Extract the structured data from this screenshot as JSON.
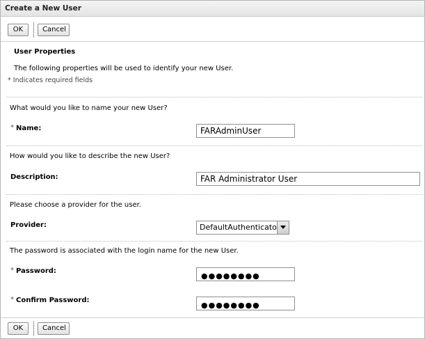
{
  "dialog": {
    "title": "Create a New User"
  },
  "buttons": {
    "ok_label": "OK",
    "cancel_label": "Cancel"
  },
  "section": {
    "heading": "User Properties",
    "intro": "The following properties will be used to identify your new User.",
    "required_note": "* Indicates required fields"
  },
  "name": {
    "prompt": "What would you like to name your new User?",
    "star": "*",
    "label": "Name:",
    "value": "FARAdminUser"
  },
  "description": {
    "prompt": "How would you like to describe the new User?",
    "label": "Description:",
    "value": "FAR Administrator User"
  },
  "provider": {
    "prompt": "Please choose a provider for the user.",
    "label": "Provider:",
    "selected": "DefaultAuthenticator"
  },
  "password": {
    "prompt": "The password is associated with the login name for the new User.",
    "star": "*",
    "label": "Password:",
    "masked": "●●●●●●●●"
  },
  "confirm_password": {
    "star": "*",
    "label": "Confirm Password:",
    "masked": "●●●●●●●●"
  }
}
